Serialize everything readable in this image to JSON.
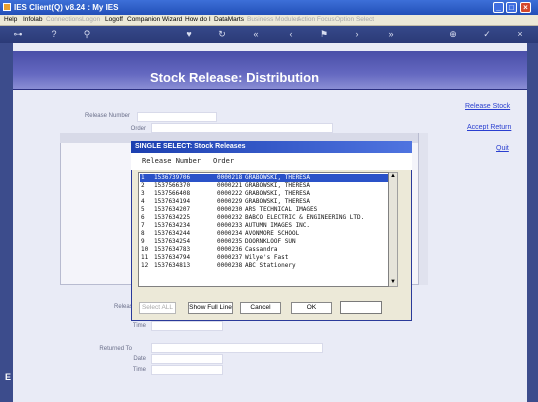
{
  "window": {
    "title": "IES Client(Q) v8.24 : My IES"
  },
  "menu": [
    {
      "label": "Help",
      "enabled": true
    },
    {
      "label": "Infolab",
      "enabled": true
    },
    {
      "label": "Connections",
      "enabled": false
    },
    {
      "label": "Logon",
      "enabled": false
    },
    {
      "label": "Logoff",
      "enabled": true
    },
    {
      "label": "Companion",
      "enabled": true
    },
    {
      "label": "Wizard",
      "enabled": true
    },
    {
      "label": "How do I",
      "enabled": true
    },
    {
      "label": "DataMarts",
      "enabled": true
    },
    {
      "label": "Business Modules",
      "enabled": false
    },
    {
      "label": "Action Focus",
      "enabled": false
    },
    {
      "label": "Option Select",
      "enabled": false
    }
  ],
  "page": {
    "title": "Stock Release: Distribution",
    "fields": {
      "release_number": "Release Number",
      "order": "Order",
      "release_short": "Releas",
      "time1": "Time",
      "returned_to": "Returned To",
      "date": "Date",
      "time2": "Time"
    },
    "links": {
      "release_stock": "Release Stock",
      "accept_return": "Accept Return",
      "quit": "Quit"
    }
  },
  "dialog": {
    "title": "SINGLE SELECT: Stock Releases",
    "columns": [
      "Release Number",
      "Order"
    ],
    "rows": [
      {
        "n": "1",
        "release": "1536739706",
        "order": "0000218",
        "customer": "GRABOWSKI, THERESA"
      },
      {
        "n": "2",
        "release": "1537566370",
        "order": "0000221",
        "customer": "GRABOWSKI, THERESA"
      },
      {
        "n": "3",
        "release": "1537566408",
        "order": "0000222",
        "customer": "GRABOWSKI, THERESA"
      },
      {
        "n": "4",
        "release": "1537634194",
        "order": "0000229",
        "customer": "GRABOWSKI, THERESA"
      },
      {
        "n": "5",
        "release": "1537634207",
        "order": "0000230",
        "customer": "ARS TECHNICAL IMAGES"
      },
      {
        "n": "6",
        "release": "1537634225",
        "order": "0000232",
        "customer": "BABCO ELECTRIC & ENGINEERING LTD."
      },
      {
        "n": "7",
        "release": "1537634234",
        "order": "0000233",
        "customer": "AUTUMN IMAGES INC."
      },
      {
        "n": "8",
        "release": "1537634244",
        "order": "0000234",
        "customer": "AVONMORE SCHOOL"
      },
      {
        "n": "9",
        "release": "1537634254",
        "order": "0000235",
        "customer": "DOORNKLOOF SUN"
      },
      {
        "n": "10",
        "release": "1537634783",
        "order": "0000236",
        "customer": "Cassandra"
      },
      {
        "n": "11",
        "release": "1537634794",
        "order": "0000237",
        "customer": "Wilye's Fast"
      },
      {
        "n": "12",
        "release": "1537634813",
        "order": "0000238",
        "customer": "ABC Stationery"
      }
    ],
    "selected_index": 0,
    "buttons": {
      "select_all": "Select ALL",
      "show_full_line": "Show Full Line",
      "cancel": "Cancel",
      "ok": "OK"
    }
  },
  "colors": {
    "accent": "#2a52c8",
    "banner": "#4a4fa8"
  }
}
